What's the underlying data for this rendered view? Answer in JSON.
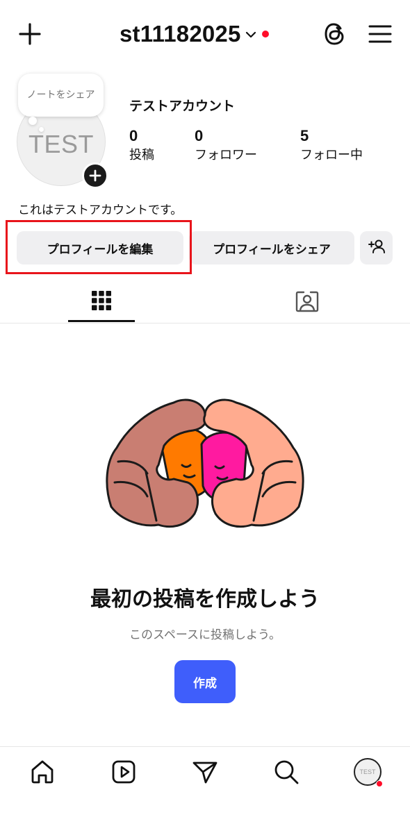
{
  "header": {
    "username": "st11182025",
    "notification_color": "#ff0d29"
  },
  "note": {
    "placeholder": "ノートをシェア"
  },
  "profile": {
    "avatar_text": "TEST",
    "display_name": "テストアカウント",
    "bio": "これはテストアカウントです。",
    "stats": [
      {
        "count": "0",
        "label": "投稿"
      },
      {
        "count": "0",
        "label": "フォロワー"
      },
      {
        "count": "5",
        "label": "フォロー中"
      }
    ]
  },
  "buttons": {
    "edit_profile": "プロフィールを編集",
    "share_profile": "プロフィールをシェア"
  },
  "tabs": [
    "grid-icon",
    "tagged-icon"
  ],
  "empty_state": {
    "title": "最初の投稿を作成しよう",
    "subtitle": "このスペースに投稿しよう。",
    "create_label": "作成",
    "accent": "#3f5efb"
  },
  "bottom_nav": {
    "items": [
      "home-icon",
      "reels-icon",
      "direct-icon",
      "search-icon",
      "profile-avatar"
    ],
    "avatar_text": "TEST"
  },
  "annotation": {
    "highlight_color": "#e8141b",
    "target": "edit-profile-button"
  }
}
